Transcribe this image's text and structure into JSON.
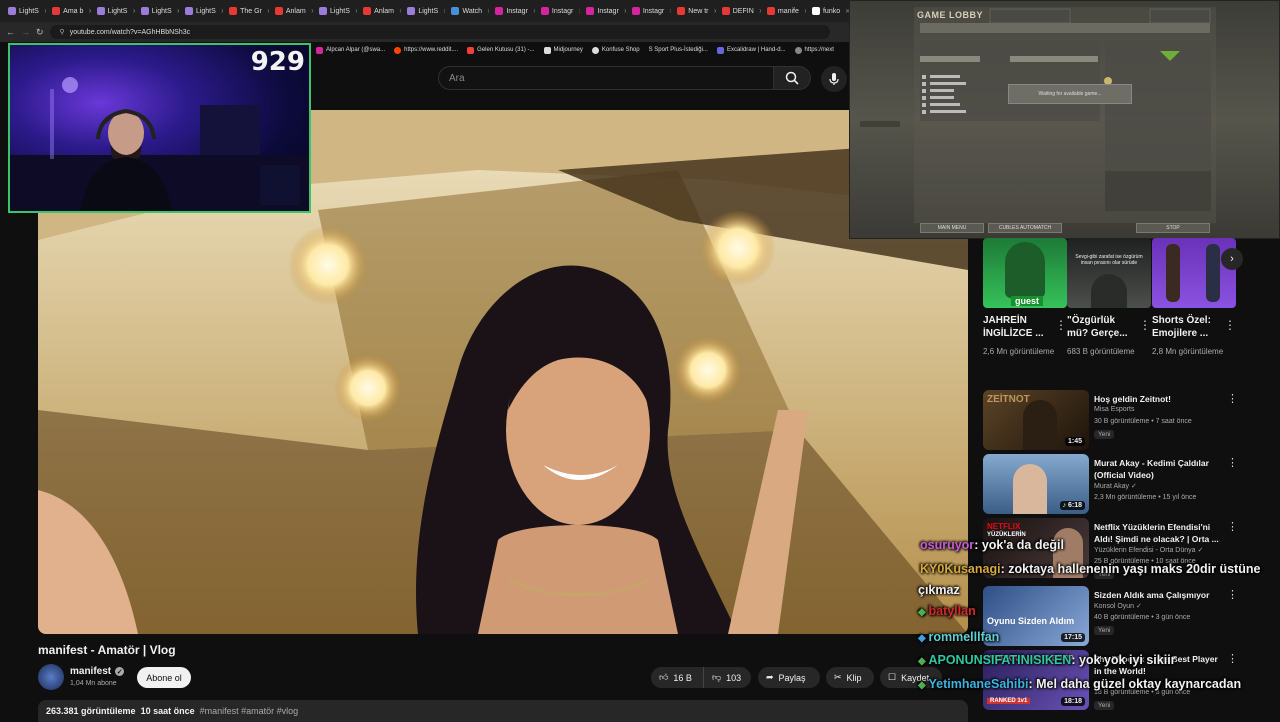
{
  "tabs": [
    {
      "label": "LightS",
      "color": "#9b7cd8"
    },
    {
      "label": "Ama b",
      "color": "#e53935"
    },
    {
      "label": "LightS",
      "color": "#9b7cd8"
    },
    {
      "label": "LightS",
      "color": "#9b7cd8"
    },
    {
      "label": "LightS",
      "color": "#9b7cd8"
    },
    {
      "label": "The Gr",
      "color": "#e53935"
    },
    {
      "label": "Anlam",
      "color": "#e53935"
    },
    {
      "label": "LightS",
      "color": "#9b7cd8"
    },
    {
      "label": "Anlam",
      "color": "#e53935"
    },
    {
      "label": "LightS",
      "color": "#9b7cd8"
    },
    {
      "label": "Watch",
      "color": "#4a90d9"
    },
    {
      "label": "Instagr",
      "color": "#d6249f"
    },
    {
      "label": "Instagr",
      "color": "#d6249f"
    },
    {
      "label": "Instagr",
      "color": "#d6249f"
    },
    {
      "label": "Instagr",
      "color": "#d6249f"
    },
    {
      "label": "New tr",
      "color": "#e53935"
    },
    {
      "label": "DEFIN",
      "color": "#e53935"
    },
    {
      "label": "manife",
      "color": "#e53935"
    },
    {
      "label": "funko",
      "color": "#ffffff"
    }
  ],
  "browser": {
    "url": "youtube.com/watch?v=AGhHBbNSh3c"
  },
  "bookmarks": [
    {
      "label": "Alpcan Alpar (@swa...",
      "color": "#d6249f"
    },
    {
      "label": "https://www.reddit....",
      "color": "#ff4500"
    },
    {
      "label": "Gelen Kutusu (31) -...",
      "color": "#ea4335"
    },
    {
      "label": "Midjourney",
      "color": "#ffffff"
    },
    {
      "label": "Konfuse Shop",
      "color": "#ffffff"
    },
    {
      "label": "S Sport Plus-İstediği...",
      "color": "#1a73e8"
    },
    {
      "label": "Excalidraw | Hand-d...",
      "color": "#6965db"
    },
    {
      "label": "https://next",
      "color": "#ffffff"
    }
  ],
  "search": {
    "placeholder": "Ara"
  },
  "webcam": {
    "count": "929"
  },
  "lobby": {
    "title": "GAME LOBBY",
    "waiting": "Waiting for available game...",
    "buttons": [
      "MAIN MENU",
      "CUBLES AUTOMATCH",
      "STOP"
    ]
  },
  "video": {
    "title": "manifest - Amatör | Vlog",
    "channel": "manifest",
    "subscribers": "1,04 Mn abone",
    "subscribe_label": "Abone ol",
    "likes": "16 B",
    "dislikes": "103",
    "share_label": "Paylaş",
    "clip_label": "Klip",
    "save_label": "Kaydet",
    "views": "263.381 görüntüleme",
    "age": "10 saat önce",
    "tags": "#manifest #amatör #vlog"
  },
  "shorts": [
    {
      "title": "JAHREİN İNGİLİZCE ...",
      "views": "2,6 Mn görüntüleme",
      "thumb_color": "#2aa046",
      "overlay": "guest"
    },
    {
      "title": "\"Özgürlük mü? Gerçe...",
      "views": "683 B görüntüleme",
      "thumb_color": "#3a3d3a",
      "overlay": "Sevgi-gibi zarafat ise özgürüm insan pırasını olar sürüde"
    },
    {
      "title": "Shorts Özel: Emojilere ...",
      "views": "2,8 Mn görüntüleme",
      "thumb_color": "#7a3fc8",
      "overlay": ""
    }
  ],
  "recommendations": [
    {
      "title": "Hoş geldin Zeitnot!",
      "channel": "Misa Esports",
      "verified": false,
      "meta": "30 B görüntüleme • 7 saat önce",
      "badge": "Yeni",
      "duration": "1:45",
      "thumb_color": "#3a2a18"
    },
    {
      "title": "Murat Akay - Kedimi Çaldılar (Official Video)",
      "channel": "Murat Akay",
      "verified": true,
      "meta": "2,3 Mn görüntüleme • 15 yıl önce",
      "badge": "",
      "duration": "♪ 6:18",
      "thumb_color": "#5e86b4"
    },
    {
      "title": "Netflix Yüzüklerin Efendisi'ni Aldı! Şimdi ne olacak? | Orta ...",
      "channel": "Yüzüklerin Efendisi - Orta Dünya",
      "verified": true,
      "meta": "25 B görüntüleme • 10 saat önce",
      "badge": "Yeni",
      "duration": "",
      "thumb_color": "#2a1d1d"
    },
    {
      "title": "Sizden Aldık ama Çalışmıyor",
      "channel": "Konsol Oyun",
      "verified": true,
      "meta": "40 B görüntüleme • 3 gün önce",
      "badge": "Yeni",
      "duration": "17:15",
      "thumb_color": "#3b5a8a"
    },
    {
      "title": "The Phoenix ... the Best Player in the World!",
      "channel": "",
      "verified": false,
      "meta": "18 B görüntüleme • 3 gün önce",
      "badge": "Yeni",
      "duration": "18:18",
      "thumb_color": "#3a2c6b"
    }
  ],
  "chat": [
    {
      "user": "osuruyor",
      "message": ": yok'a da değil",
      "user_color": "#c85adb"
    },
    {
      "user": "KY0Kusanagi",
      "message": ": zoktaya hallenenin yaşı maks 20dir üstüne",
      "user_color": "#d7a83c"
    },
    {
      "user": "",
      "message": "çıkmaz",
      "user_color": "#ffffff"
    },
    {
      "user": "batyllan",
      "message": "",
      "user_color": "#d02a2a"
    },
    {
      "user": "rommelllfan",
      "message": "",
      "user_color": "#5ed0d0"
    },
    {
      "user": "APONUNSIFATINISIKEN",
      "message": ": yok yok iyi sikiir",
      "user_color": "#2bc9a4"
    },
    {
      "user": "YetimhaneSahibi",
      "message": ": Mel daha güzel oktay kaynarcadan",
      "user_color": "#3bb4e0"
    }
  ]
}
